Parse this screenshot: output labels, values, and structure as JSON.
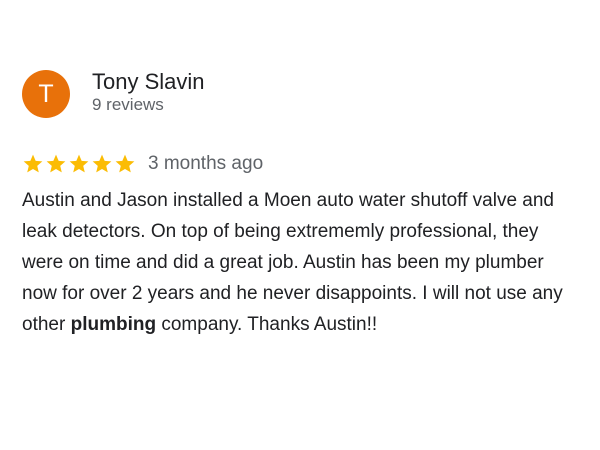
{
  "review": {
    "avatar_letter": "T",
    "avatar_color": "#e8710a",
    "reviewer_name": "Tony Slavin",
    "review_count": "9 reviews",
    "rating": 5,
    "rating_max": 5,
    "star_color": "#fbbc04",
    "date": "3 months ago",
    "text_before": "Austin and Jason installed a Moen auto water shutoff valve and leak detectors. On top of being extrememly professional, they were on time and did a great job. Austin has been my plumber now for over 2 years and he never disappoints. I will not use any other ",
    "text_highlight": "plumbing",
    "text_after": " company. Thanks Austin!!"
  }
}
